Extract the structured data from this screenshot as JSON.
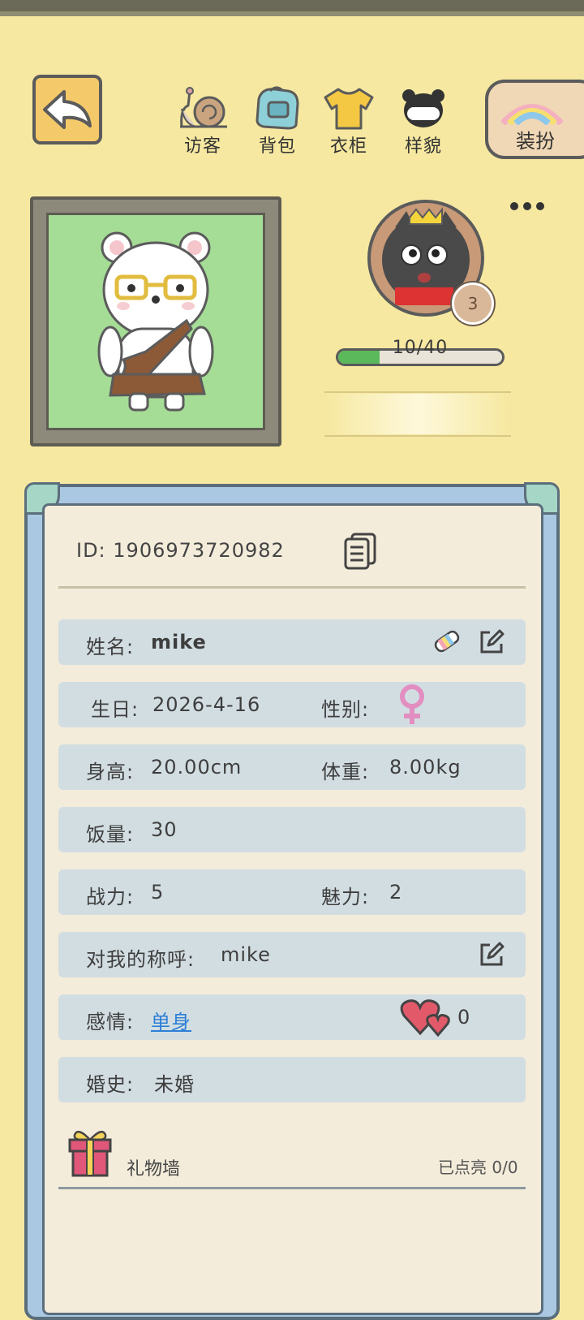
{
  "nav": {
    "back_icon": "back-arrow-icon",
    "items": [
      {
        "label": "访客",
        "icon": "snail-icon"
      },
      {
        "label": "背包",
        "icon": "backpack-icon"
      },
      {
        "label": "衣柜",
        "icon": "shirt-icon"
      },
      {
        "label": "样貌",
        "icon": "panda-face-icon"
      }
    ],
    "dress_up_label": "装扮"
  },
  "pet": {
    "level": "3",
    "exp_text": "10/40",
    "exp_progress": 0.25
  },
  "profile": {
    "id_text": "ID: 1906973720982",
    "name_label": "姓名:",
    "name_value": "mike",
    "birthday_label": "生日:",
    "birthday_value": "2026-4-16",
    "gender_label": "性别:",
    "gender_icon": "female-symbol-icon",
    "height_label": "身高:",
    "height_value": "20.00cm",
    "weight_label": "体重:",
    "weight_value": "8.00kg",
    "food_label": "饭量:",
    "food_value": "30",
    "power_label": "战力:",
    "power_value": "5",
    "charm_label": "魅力:",
    "charm_value": "2",
    "nickname_label": "对我的称呼:",
    "nickname_value": "mike",
    "relationship_label": "感情:",
    "relationship_value": "单身",
    "hearts_count": "0",
    "marriage_label": "婚史:",
    "marriage_value": "未婚"
  },
  "gift_wall": {
    "label": "礼物墙",
    "count_text": "已点亮  0/0"
  },
  "colors": {
    "background": "#f6e8a0",
    "card_border": "#aac8e2",
    "row_bg": "#d2dde2",
    "link": "#2d7fd6",
    "exp_fill": "#5bb85b"
  }
}
